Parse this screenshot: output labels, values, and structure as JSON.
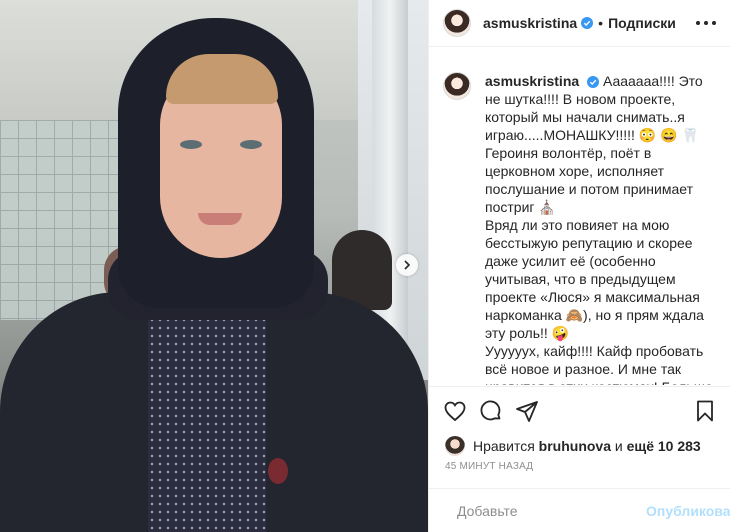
{
  "header": {
    "username": "asmuskristina",
    "separator": "•",
    "follow_label": "Подписки"
  },
  "caption": {
    "username": "asmuskristina",
    "text": "Ааааааа!!!! Это не шутка!!!! В новом проекте, который мы начали снимать..я играю.....МОНАШКУ!!!!! 😳 😄 🦷\nГероиня волонтёр, поёт в церковном хоре, исполняет послушание и потом принимает постриг ⛪\nВряд ли это повияет на мою бесстыжую репутацию и скорее даже усилит её (особенно учитывая, что в предыдущем проекте «Люся» я максимальная                наркоманка 🙈), но я прям ждала эту роль!! 🤪\nУууууух, кайф!!!! Кайф пробовать всё новое и разное. И мне так нравится в этих костюмах! Больше, чем в чулках и коротких платьях 🤪 🙈\n\nИ это... Как тебе такое, Иван Охлобыстин? 😂 😂 😂 😂 😂"
  },
  "likes": {
    "prefix": "Нравится",
    "user": "bruhunova",
    "middle": "и",
    "count": "ещё 10 283"
  },
  "timestamp": "45 минут назад",
  "comment": {
    "placeholder": "Добавьте",
    "publish_label": "Опубликовать"
  },
  "icons": {
    "verified": "verified-badge-icon",
    "more": "more-options-icon",
    "like": "heart-icon",
    "comment": "comment-icon",
    "share": "share-icon",
    "save": "bookmark-icon",
    "emoji": "emoji-icon",
    "next": "chevron-right-icon"
  },
  "colors": {
    "verified": "#3897f0",
    "publish_disabled": "#b2dffc",
    "meta_gray": "#8e8e8e",
    "text": "#262626"
  }
}
